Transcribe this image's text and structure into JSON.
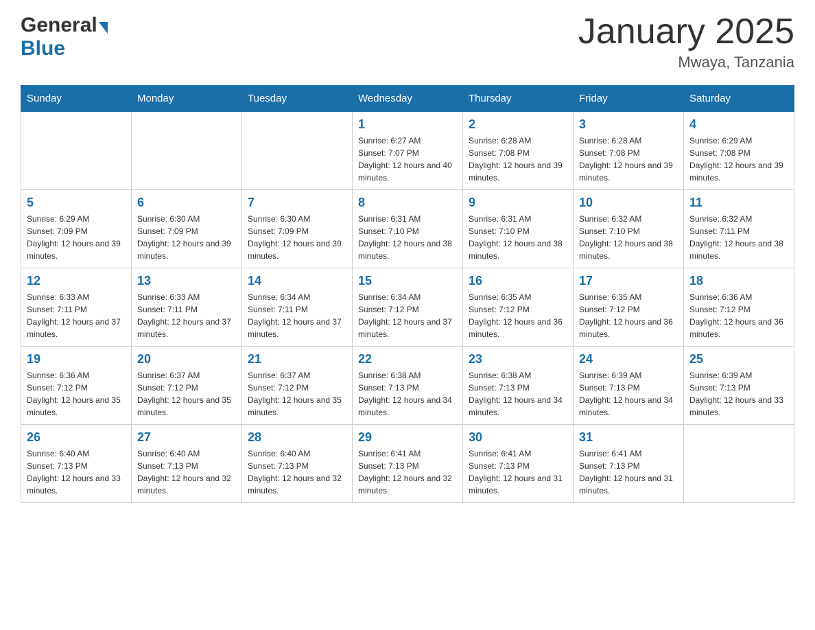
{
  "header": {
    "logo_general": "General",
    "logo_blue": "Blue",
    "title": "January 2025",
    "subtitle": "Mwaya, Tanzania"
  },
  "days_of_week": [
    "Sunday",
    "Monday",
    "Tuesday",
    "Wednesday",
    "Thursday",
    "Friday",
    "Saturday"
  ],
  "weeks": [
    [
      {
        "day": "",
        "info": ""
      },
      {
        "day": "",
        "info": ""
      },
      {
        "day": "",
        "info": ""
      },
      {
        "day": "1",
        "info": "Sunrise: 6:27 AM\nSunset: 7:07 PM\nDaylight: 12 hours and 40 minutes."
      },
      {
        "day": "2",
        "info": "Sunrise: 6:28 AM\nSunset: 7:08 PM\nDaylight: 12 hours and 39 minutes."
      },
      {
        "day": "3",
        "info": "Sunrise: 6:28 AM\nSunset: 7:08 PM\nDaylight: 12 hours and 39 minutes."
      },
      {
        "day": "4",
        "info": "Sunrise: 6:29 AM\nSunset: 7:08 PM\nDaylight: 12 hours and 39 minutes."
      }
    ],
    [
      {
        "day": "5",
        "info": "Sunrise: 6:29 AM\nSunset: 7:09 PM\nDaylight: 12 hours and 39 minutes."
      },
      {
        "day": "6",
        "info": "Sunrise: 6:30 AM\nSunset: 7:09 PM\nDaylight: 12 hours and 39 minutes."
      },
      {
        "day": "7",
        "info": "Sunrise: 6:30 AM\nSunset: 7:09 PM\nDaylight: 12 hours and 39 minutes."
      },
      {
        "day": "8",
        "info": "Sunrise: 6:31 AM\nSunset: 7:10 PM\nDaylight: 12 hours and 38 minutes."
      },
      {
        "day": "9",
        "info": "Sunrise: 6:31 AM\nSunset: 7:10 PM\nDaylight: 12 hours and 38 minutes."
      },
      {
        "day": "10",
        "info": "Sunrise: 6:32 AM\nSunset: 7:10 PM\nDaylight: 12 hours and 38 minutes."
      },
      {
        "day": "11",
        "info": "Sunrise: 6:32 AM\nSunset: 7:11 PM\nDaylight: 12 hours and 38 minutes."
      }
    ],
    [
      {
        "day": "12",
        "info": "Sunrise: 6:33 AM\nSunset: 7:11 PM\nDaylight: 12 hours and 37 minutes."
      },
      {
        "day": "13",
        "info": "Sunrise: 6:33 AM\nSunset: 7:11 PM\nDaylight: 12 hours and 37 minutes."
      },
      {
        "day": "14",
        "info": "Sunrise: 6:34 AM\nSunset: 7:11 PM\nDaylight: 12 hours and 37 minutes."
      },
      {
        "day": "15",
        "info": "Sunrise: 6:34 AM\nSunset: 7:12 PM\nDaylight: 12 hours and 37 minutes."
      },
      {
        "day": "16",
        "info": "Sunrise: 6:35 AM\nSunset: 7:12 PM\nDaylight: 12 hours and 36 minutes."
      },
      {
        "day": "17",
        "info": "Sunrise: 6:35 AM\nSunset: 7:12 PM\nDaylight: 12 hours and 36 minutes."
      },
      {
        "day": "18",
        "info": "Sunrise: 6:36 AM\nSunset: 7:12 PM\nDaylight: 12 hours and 36 minutes."
      }
    ],
    [
      {
        "day": "19",
        "info": "Sunrise: 6:36 AM\nSunset: 7:12 PM\nDaylight: 12 hours and 35 minutes."
      },
      {
        "day": "20",
        "info": "Sunrise: 6:37 AM\nSunset: 7:12 PM\nDaylight: 12 hours and 35 minutes."
      },
      {
        "day": "21",
        "info": "Sunrise: 6:37 AM\nSunset: 7:12 PM\nDaylight: 12 hours and 35 minutes."
      },
      {
        "day": "22",
        "info": "Sunrise: 6:38 AM\nSunset: 7:13 PM\nDaylight: 12 hours and 34 minutes."
      },
      {
        "day": "23",
        "info": "Sunrise: 6:38 AM\nSunset: 7:13 PM\nDaylight: 12 hours and 34 minutes."
      },
      {
        "day": "24",
        "info": "Sunrise: 6:39 AM\nSunset: 7:13 PM\nDaylight: 12 hours and 34 minutes."
      },
      {
        "day": "25",
        "info": "Sunrise: 6:39 AM\nSunset: 7:13 PM\nDaylight: 12 hours and 33 minutes."
      }
    ],
    [
      {
        "day": "26",
        "info": "Sunrise: 6:40 AM\nSunset: 7:13 PM\nDaylight: 12 hours and 33 minutes."
      },
      {
        "day": "27",
        "info": "Sunrise: 6:40 AM\nSunset: 7:13 PM\nDaylight: 12 hours and 32 minutes."
      },
      {
        "day": "28",
        "info": "Sunrise: 6:40 AM\nSunset: 7:13 PM\nDaylight: 12 hours and 32 minutes."
      },
      {
        "day": "29",
        "info": "Sunrise: 6:41 AM\nSunset: 7:13 PM\nDaylight: 12 hours and 32 minutes."
      },
      {
        "day": "30",
        "info": "Sunrise: 6:41 AM\nSunset: 7:13 PM\nDaylight: 12 hours and 31 minutes."
      },
      {
        "day": "31",
        "info": "Sunrise: 6:41 AM\nSunset: 7:13 PM\nDaylight: 12 hours and 31 minutes."
      },
      {
        "day": "",
        "info": ""
      }
    ]
  ]
}
